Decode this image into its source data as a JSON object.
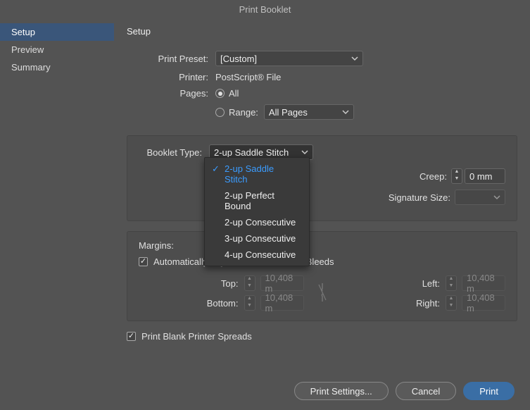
{
  "window": {
    "title": "Print Booklet"
  },
  "sidebar": {
    "items": [
      {
        "label": "Setup",
        "selected": true
      },
      {
        "label": "Preview",
        "selected": false
      },
      {
        "label": "Summary",
        "selected": false
      }
    ]
  },
  "main": {
    "heading": "Setup",
    "print_preset_label": "Print Preset:",
    "print_preset_value": "[Custom]",
    "printer_label": "Printer:",
    "printer_value": "PostScript® File",
    "pages_label": "Pages:",
    "pages_all": "All",
    "pages_range_label": "Range:",
    "pages_range_value": "All Pages",
    "pages_mode": "all",
    "booklet_type_label": "Booklet Type:",
    "booklet_type_value": "2-up Saddle Stitch",
    "booklet_type_options": [
      "2-up Saddle Stitch",
      "2-up Perfect Bound",
      "2-up Consecutive",
      "3-up Consecutive",
      "4-up Consecutive"
    ],
    "creep_label": "Creep:",
    "creep_value": "0 mm",
    "signature_size_label": "Signature Size:",
    "signature_size_value": "",
    "margins_label": "Margins:",
    "auto_adjust_label": "Automatically Adjust to Fit Marks and Bleeds",
    "auto_adjust_checked": true,
    "margin_top_label": "Top:",
    "margin_top_value": "10,408 m",
    "margin_bottom_label": "Bottom:",
    "margin_bottom_value": "10,408 m",
    "margin_left_label": "Left:",
    "margin_left_value": "10,408 m",
    "margin_right_label": "Right:",
    "margin_right_value": "10,408 m",
    "print_blank_label": "Print Blank Printer Spreads",
    "print_blank_checked": true
  },
  "footer": {
    "print_settings": "Print Settings...",
    "cancel": "Cancel",
    "print": "Print"
  }
}
